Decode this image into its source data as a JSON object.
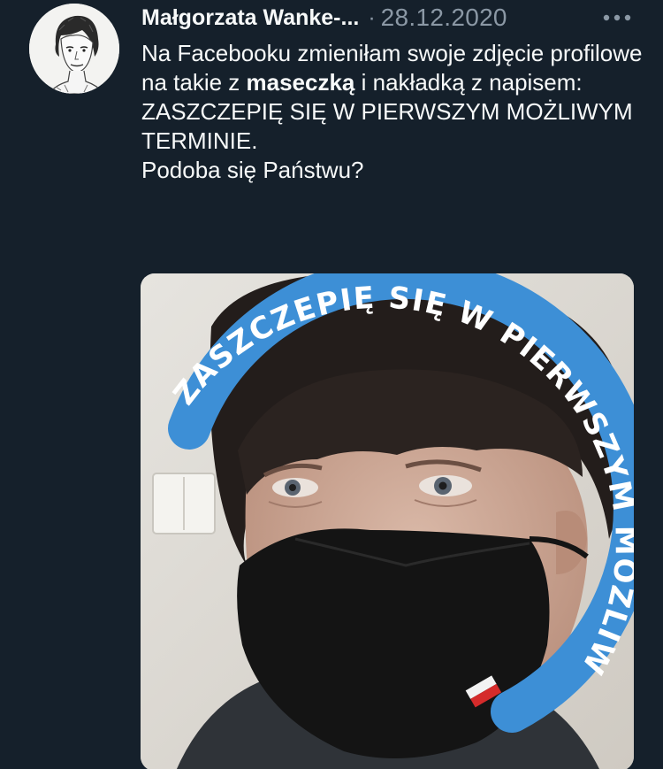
{
  "tweet": {
    "author_name": "Małgorzata Wanke-...",
    "separator": "·",
    "date": "28.12.2020",
    "more_icon": "more-horizontal-icon",
    "text": {
      "line1_before": "Na Facebooku zmieniłam swoje zdjęcie profilowe na takie z ",
      "bold": "maseczką",
      "line1_after": " i nakładką z napisem: ZASZCZEPIĘ SIĘ W PIERWSZYM MOŻLIWYM TERMINIE.",
      "line2": "Podoba się Państwu?"
    },
    "media": {
      "overlay_text": "ZASZCZEPIĘ SIĘ W PIERWSZYM MOŻLIWYM TERMINIE",
      "ring_color": "#3d8fd6"
    }
  }
}
